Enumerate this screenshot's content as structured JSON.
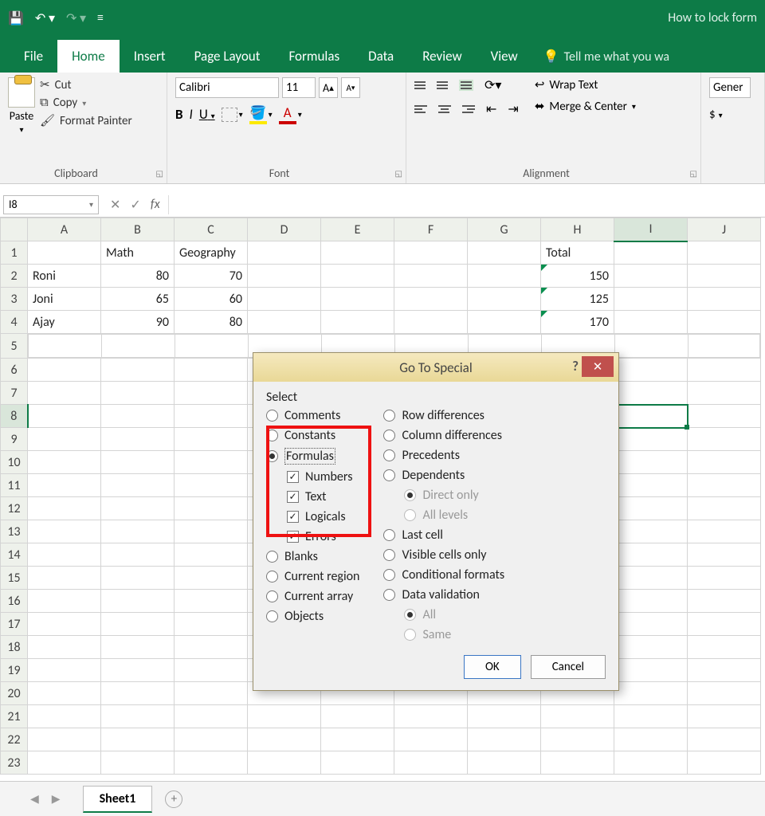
{
  "titlebar": {
    "doc_title": "How to lock form"
  },
  "tabs": {
    "file": "File",
    "home": "Home",
    "insert": "Insert",
    "page_layout": "Page Layout",
    "formulas": "Formulas",
    "data": "Data",
    "review": "Review",
    "view": "View",
    "tell_me": "Tell me what you wa"
  },
  "ribbon": {
    "clipboard": {
      "paste": "Paste",
      "cut": "Cut",
      "copy": "Copy",
      "format_painter": "Format Painter",
      "label": "Clipboard"
    },
    "font": {
      "name": "Calibri",
      "size": "11",
      "b": "B",
      "i": "I",
      "u": "U",
      "a": "A",
      "label": "Font"
    },
    "alignment": {
      "wrap": "Wrap Text",
      "merge": "Merge & Center",
      "label": "Alignment"
    },
    "number": {
      "format": "Gener",
      "symbol": "$",
      "label": ""
    }
  },
  "formula_bar": {
    "name_box": "I8",
    "fx": "fx"
  },
  "columns": [
    "",
    "A",
    "B",
    "C",
    "D",
    "E",
    "F",
    "G",
    "H",
    "I",
    "J"
  ],
  "rows": [
    {
      "n": "1",
      "cells": [
        "",
        "Math",
        "Geography",
        "",
        "",
        "",
        "",
        "Total",
        "",
        ""
      ]
    },
    {
      "n": "2",
      "cells": [
        "Roni",
        "80",
        "70",
        "",
        "",
        "",
        "",
        "150",
        "",
        ""
      ]
    },
    {
      "n": "3",
      "cells": [
        "Joni",
        "65",
        "60",
        "",
        "",
        "",
        "",
        "125",
        "",
        ""
      ]
    },
    {
      "n": "4",
      "cells": [
        "Ajay",
        "90",
        "80",
        "",
        "",
        "",
        "",
        "170",
        "",
        ""
      ]
    },
    {
      "n": "5"
    },
    {
      "n": "6"
    },
    {
      "n": "7"
    },
    {
      "n": "8"
    },
    {
      "n": "9"
    },
    {
      "n": "10"
    },
    {
      "n": "11"
    },
    {
      "n": "12"
    },
    {
      "n": "13"
    },
    {
      "n": "14"
    },
    {
      "n": "15"
    },
    {
      "n": "16"
    },
    {
      "n": "17"
    },
    {
      "n": "18"
    },
    {
      "n": "19"
    },
    {
      "n": "20"
    },
    {
      "n": "21"
    },
    {
      "n": "22"
    },
    {
      "n": "23"
    }
  ],
  "sheet_tab": "Sheet1",
  "dialog": {
    "title": "Go To Special",
    "select": "Select",
    "left": {
      "comments": "Comments",
      "constants": "Constants",
      "formulas": "Formulas",
      "numbers": "Numbers",
      "text": "Text",
      "logicals": "Logicals",
      "errors": "Errors",
      "blanks": "Blanks",
      "curr_region": "Current region",
      "curr_array": "Current array",
      "objects": "Objects"
    },
    "right": {
      "row_diff": "Row differences",
      "col_diff": "Column differences",
      "precedents": "Precedents",
      "dependents": "Dependents",
      "direct": "Direct only",
      "all_levels": "All levels",
      "last_cell": "Last cell",
      "visible": "Visible cells only",
      "cond": "Conditional formats",
      "data_val": "Data validation",
      "all": "All",
      "same": "Same"
    },
    "ok": "OK",
    "cancel": "Cancel"
  }
}
